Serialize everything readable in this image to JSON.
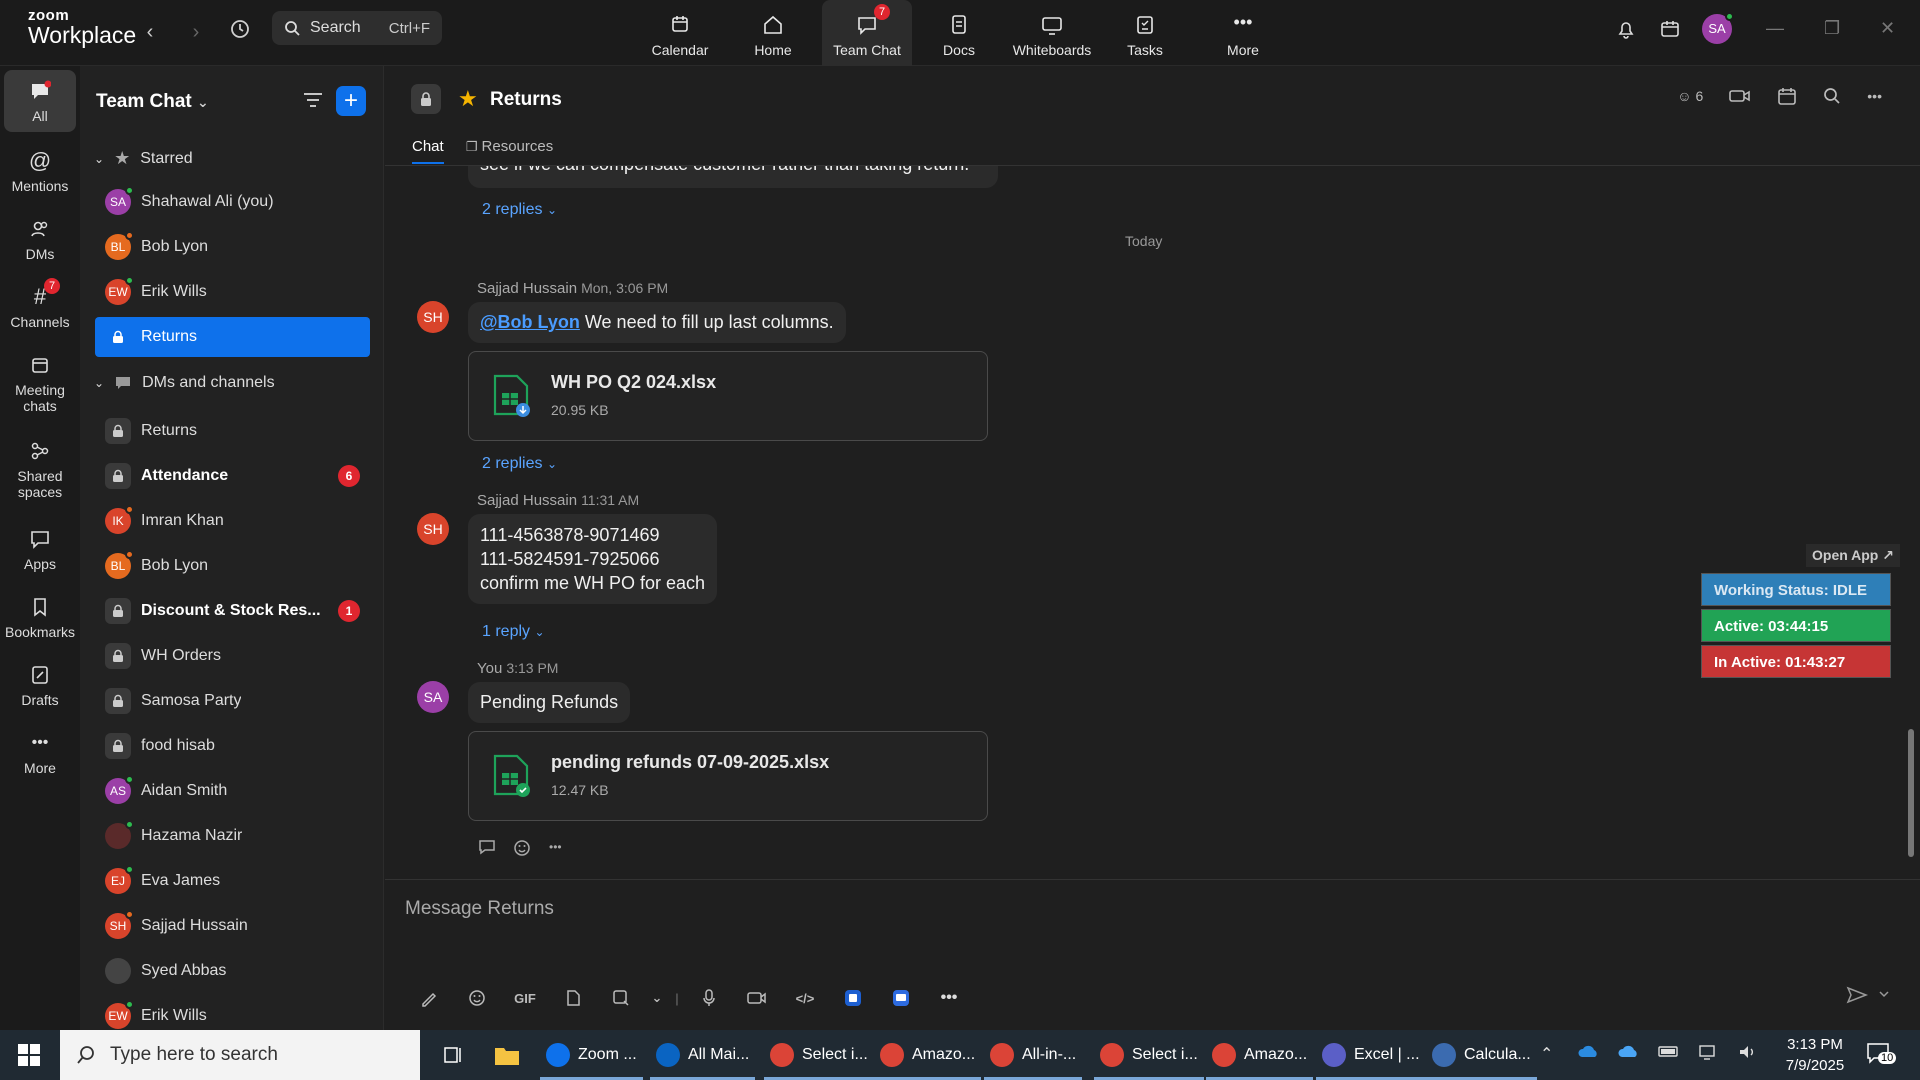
{
  "app": {
    "logo_line1": "zoom",
    "logo_line2": "Workplace",
    "search_label": "Search",
    "search_shortcut": "Ctrl+F",
    "user_initials": "SA"
  },
  "topnav": [
    {
      "label": "Calendar",
      "icon": "calendar-icon"
    },
    {
      "label": "Home",
      "icon": "home-icon"
    },
    {
      "label": "Team Chat",
      "icon": "chat-icon",
      "badge": "7",
      "active": true
    },
    {
      "label": "Docs",
      "icon": "docs-icon"
    },
    {
      "label": "Whiteboards",
      "icon": "whiteboard-icon"
    },
    {
      "label": "Tasks",
      "icon": "tasks-icon"
    },
    {
      "label": "More",
      "icon": "more-icon"
    }
  ],
  "rail": [
    {
      "label": "All",
      "icon": "chat-bubble-icon",
      "active": true
    },
    {
      "label": "Mentions",
      "icon": "at-icon"
    },
    {
      "label": "DMs",
      "icon": "people-icon"
    },
    {
      "label": "Channels",
      "icon": "hash-icon",
      "badge": "7"
    },
    {
      "label": "Meeting chats",
      "icon": "calendar-icon"
    },
    {
      "label": "Shared spaces",
      "icon": "shared-icon"
    },
    {
      "label": "Apps",
      "icon": "apps-icon"
    },
    {
      "label": "Bookmarks",
      "icon": "bookmark-icon"
    },
    {
      "label": "Drafts",
      "icon": "drafts-icon"
    },
    {
      "label": "More",
      "icon": "more-icon"
    }
  ],
  "sidebar": {
    "title": "Team Chat",
    "starred_label": "Starred",
    "starred": [
      {
        "name": "Shahawal Ali (you)",
        "initials": "SA",
        "color": "#9b3fa7",
        "status": "#2dbb4f"
      },
      {
        "name": "Bob Lyon",
        "initials": "BL",
        "color": "#e56a1f",
        "status": "#e56a1f"
      },
      {
        "name": "Erik Wills",
        "initials": "EW",
        "color": "#d9442b",
        "status": "#2dbb4f"
      },
      {
        "name": "Returns",
        "lock": true,
        "selected": true
      }
    ],
    "dms_label": "DMs and channels",
    "dms": [
      {
        "name": "Returns",
        "lock": true
      },
      {
        "name": "Attendance",
        "lock": true,
        "bold": true,
        "count": "6"
      },
      {
        "name": "Imran Khan",
        "initials": "IK",
        "color": "#d9442b",
        "status": "#e56a1f"
      },
      {
        "name": "Bob Lyon",
        "initials": "BL",
        "color": "#e56a1f",
        "status": "#e56a1f"
      },
      {
        "name": "Discount & Stock Res...",
        "lock": true,
        "bold": true,
        "count": "1"
      },
      {
        "name": "WH Orders",
        "lock": true
      },
      {
        "name": "Samosa Party",
        "lock": true
      },
      {
        "name": "food hisab",
        "lock": true
      },
      {
        "name": "Aidan Smith",
        "initials": "AS",
        "color": "#9b3fa7",
        "status": "#2dbb4f"
      },
      {
        "name": "Hazama Nazir",
        "initials": "",
        "color": "#5a2a2a",
        "status": "#2dbb4f"
      },
      {
        "name": "Eva James",
        "initials": "EJ",
        "color": "#d9442b",
        "status": "#2dbb4f"
      },
      {
        "name": "Sajjad Hussain",
        "initials": "SH",
        "color": "#d9442b",
        "status": "#e56a1f"
      },
      {
        "name": "Syed Abbas",
        "initials": "",
        "color": "#444",
        "status": ""
      },
      {
        "name": "Erik Wills",
        "initials": "EW",
        "color": "#d9442b",
        "status": "#2dbb4f"
      }
    ]
  },
  "channel": {
    "name": "Returns",
    "tab_chat": "Chat",
    "tab_resources": "Resources",
    "member_count": "6"
  },
  "messages": {
    "partial_text": "see if we can compensate customer rather than taking return.",
    "replies_1": "2 replies",
    "today": "Today",
    "m1_sender": "Sajjad Hussain",
    "m1_time": "Mon, 3:06 PM",
    "m1_initials": "SH",
    "m1_mention": "@Bob Lyon",
    "m1_text": " We need to fill up last columns.",
    "m1_file_name": "WH PO Q2 024.xlsx",
    "m1_file_size": "20.95 KB",
    "replies_2": "2 replies",
    "m2_sender": "Sajjad Hussain",
    "m2_time": "11:31 AM",
    "m2_initials": "SH",
    "m2_line1": "111-4563878-9071469",
    "m2_line2": "111-5824591-7925066",
    "m2_line3": "confirm me WH PO for each",
    "replies_3": "1 reply",
    "m3_sender": "You",
    "m3_time": "3:13 PM",
    "m3_initials": "SA",
    "m3_text": "Pending Refunds",
    "m3_file_name": "pending refunds 07-09-2025.xlsx",
    "m3_file_size": "12.47 KB"
  },
  "status_widget": {
    "open_app": "Open App ↗",
    "working": "Working Status: IDLE",
    "active": "Active: 03:44:15",
    "inactive": "In Active: 01:43:27"
  },
  "composer": {
    "placeholder": "Message Returns",
    "gif_label": "GIF"
  },
  "taskbar": {
    "search_placeholder": "Type here to search",
    "apps": [
      {
        "label": "Zoom ...",
        "color": "#0e71eb"
      },
      {
        "label": "All Mai...",
        "color": "#0a64c2"
      },
      {
        "label": "Select i...",
        "color": "#db4437"
      },
      {
        "label": "Amazo...",
        "color": "#db4437"
      },
      {
        "label": "All-in-...",
        "color": "#db4437"
      },
      {
        "label": "Select i...",
        "color": "#db4437"
      },
      {
        "label": "Amazo...",
        "color": "#db4437"
      },
      {
        "label": "Excel | ...",
        "color": "#5b5fc7"
      },
      {
        "label": "Calcula...",
        "color": "#3b6bb0"
      }
    ],
    "time": "3:13 PM",
    "date": "7/9/2025",
    "notifications": "10"
  }
}
